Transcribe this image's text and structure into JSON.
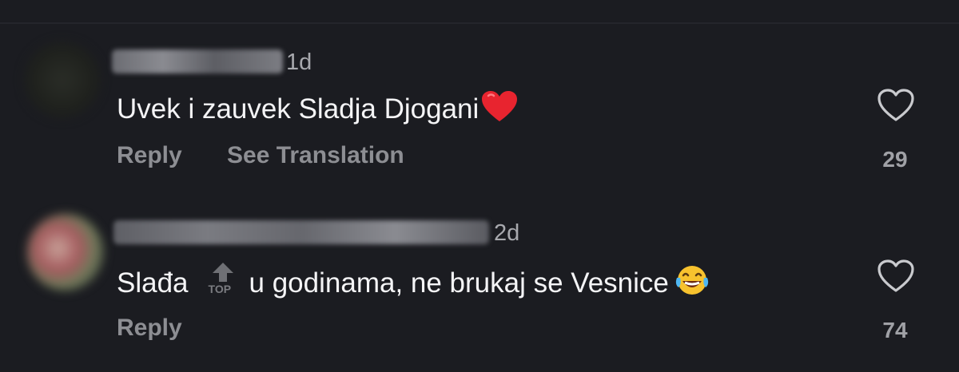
{
  "comments": [
    {
      "time": "1d",
      "text": "Uvek i zauvek Sladja Djogani",
      "emoji": "red-heart",
      "actions": {
        "reply": "Reply",
        "translate": "See Translation"
      },
      "likes": "29",
      "like_icon": "heart-outline-icon"
    },
    {
      "time": "2d",
      "text_before": "Slađa",
      "inline_icon_label": "TOP",
      "text_after": "u godinama, ne brukaj se Vesnice",
      "emoji": "face-with-tears-of-joy",
      "actions": {
        "reply": "Reply"
      },
      "likes": "74",
      "like_icon": "heart-outline-icon"
    }
  ],
  "colors": {
    "background": "#1b1c21",
    "primary_text": "#f4f4f6",
    "secondary_text": "#8d8e93",
    "timestamp": "#a8a9ae"
  }
}
